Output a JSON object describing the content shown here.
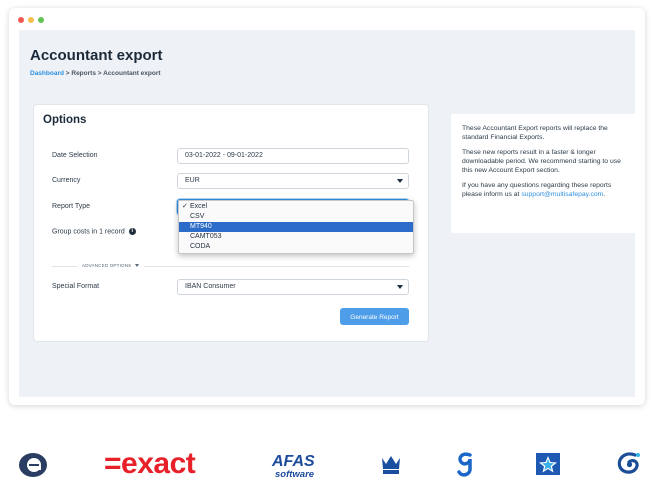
{
  "header": {
    "title": "Accountant export",
    "breadcrumb": {
      "link": "Dashboard",
      "separator": ">",
      "reports": "Reports",
      "current": "Accountant export"
    }
  },
  "options": {
    "title": "Options",
    "date_selection": {
      "label": "Date Selection",
      "value": "03-01-2022 - 09-01-2022"
    },
    "currency": {
      "label": "Currency",
      "value": "EUR"
    },
    "report_type": {
      "label": "Report Type",
      "options": [
        "Excel",
        "CSV",
        "MT940",
        "CAMT053",
        "CODA"
      ],
      "checked_option": "Excel",
      "highlighted_option": "MT940"
    },
    "group_costs": {
      "label": "Group costs in 1 record",
      "info_icon": "i"
    },
    "advanced_options": "ADVANCED OPTIONS",
    "special_format": {
      "label": "Special Format",
      "value": "IBAN Consumer"
    },
    "generate_button": "Generate Report"
  },
  "info_panel": {
    "paragraph1": "These Accountant Export reports will replace the standard Financial Exports.",
    "paragraph2": "These new reports result in a faster & longer downloadable period. We recommend starting to use this new Account Export section.",
    "paragraph3": "If you have any questions regarding these reports please inform us at",
    "email": "support@multisafepay.com",
    "period": "."
  },
  "logos": {
    "exact": "=exact",
    "afas_top": "AFAS",
    "afas_bottom": "software",
    "icons": [
      "e-circle-logo",
      "exact-logo",
      "afas-logo",
      "crown-logo",
      "g-logo",
      "star-box-logo",
      "swirl-logo"
    ]
  },
  "colors": {
    "accent": "#2f8fe0",
    "button": "#4d9de8",
    "selected_option": "#2d6cc9",
    "exact_red": "#e8202a",
    "afas_blue": "#1d4b9b"
  }
}
